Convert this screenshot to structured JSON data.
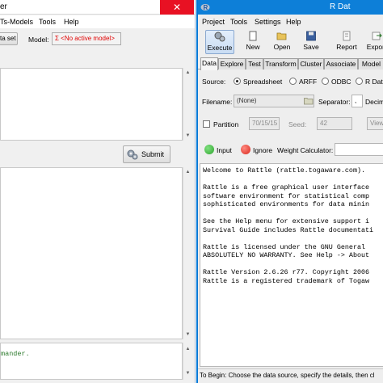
{
  "rcmdr": {
    "title": "er",
    "menus": [
      "Ts-Models",
      "Tools",
      "Help"
    ],
    "data_set_button": "ta set",
    "model_label": "Model:",
    "model_value": "Σ <No active model>",
    "submit_label": "Submit",
    "messages_text": "mander."
  },
  "rattle": {
    "title": "R Dat",
    "menus": [
      "Project",
      "Tools",
      "Settings",
      "Help"
    ],
    "toolbar": [
      "Execute",
      "New",
      "Open",
      "Save",
      "Report",
      "Export"
    ],
    "tabs": [
      "Data",
      "Explore",
      "Test",
      "Transform",
      "Cluster",
      "Associate",
      "Model"
    ],
    "source_label": "Source:",
    "sources": [
      "Spreadsheet",
      "ARFF",
      "ODBC",
      "R Dat"
    ],
    "filename_label": "Filename:",
    "filename_value": "(None)",
    "separator_label": "Separator:",
    "separator_value": ",",
    "decimal_label": "Decim",
    "partition_label": "Partition",
    "partition_value": "70/15/15",
    "seed_label": "Seed:",
    "seed_value": "42",
    "view_label": "View",
    "input_label": "Input",
    "ignore_label": "Ignore",
    "weight_label": "Weight Calculator:",
    "text_lines": [
      "Welcome to Rattle (rattle.togaware.com).",
      "",
      "Rattle is a free graphical user interface",
      "software environment for statistical comp",
      "sophisticated environments for data minin",
      "",
      "See the Help menu for extensive support i",
      "Survival Guide includes Rattle documentati",
      "",
      "Rattle is licensed under the GNU General ",
      "ABSOLUTELY NO WARRANTY. See Help -> About",
      "",
      "Rattle Version 2.6.26 r77. Copyright 2006",
      "Rattle is a registered trademark of Togaw"
    ],
    "status": "To Begin: Choose the data source, specify the details, then cl"
  },
  "colors": {
    "close_red": "#e81123",
    "rattle_title_blue": "#0d7fd8",
    "input_green": "#2fa52f",
    "ignore_red": "#d9261c",
    "messages_green": "#2c7a2c"
  }
}
